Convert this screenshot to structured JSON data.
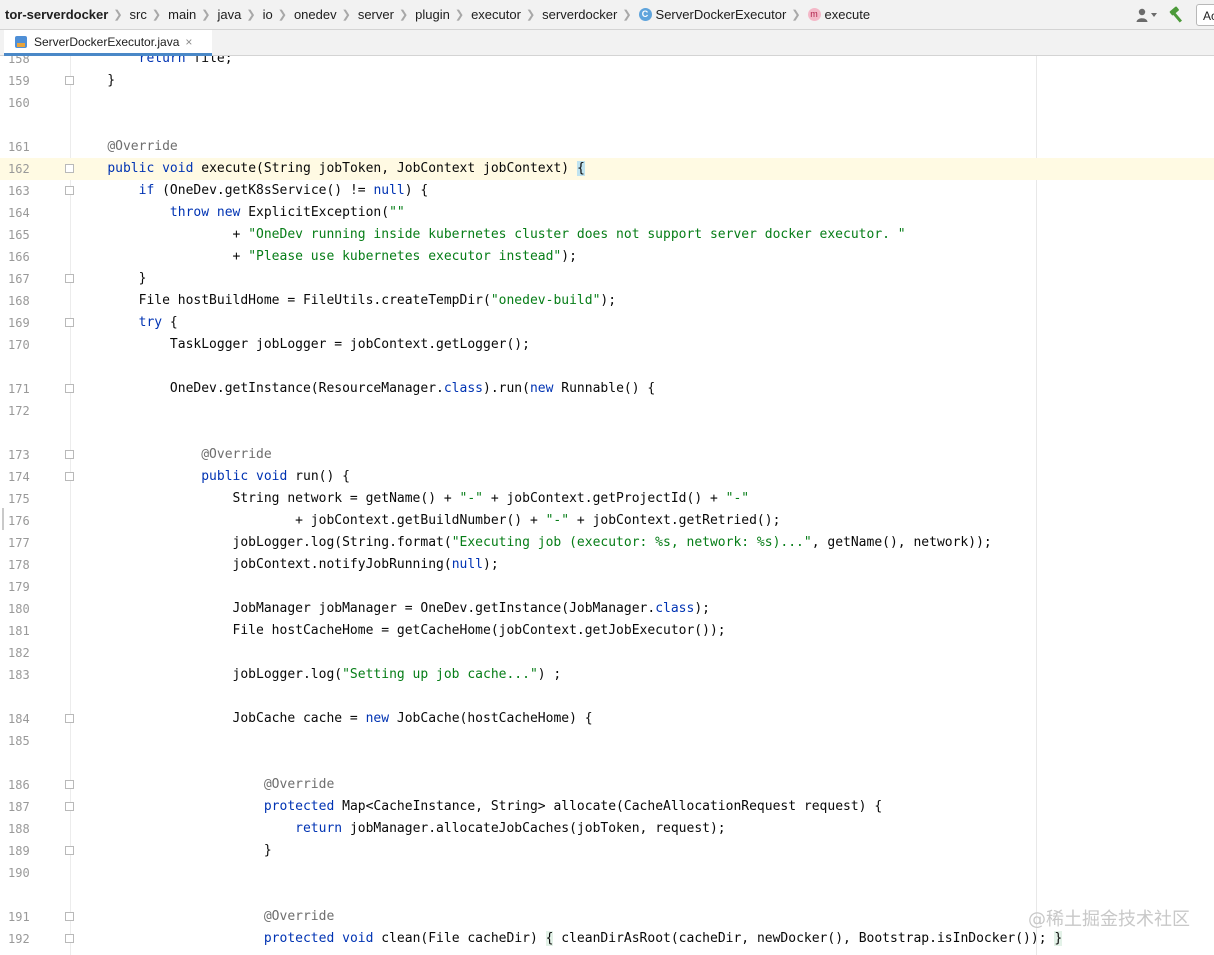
{
  "breadcrumb": {
    "items": [
      "tor-serverdocker",
      "src",
      "main",
      "java",
      "io",
      "onedev",
      "server",
      "plugin",
      "executor",
      "serverdocker",
      "ServerDockerExecutor",
      "execute"
    ],
    "class_badge": "C",
    "method_badge": "m"
  },
  "toolbar": {
    "right_button_label": "Ac"
  },
  "tab": {
    "label": "ServerDockerExecutor.java",
    "close": "×"
  },
  "editor": {
    "current_line": 162,
    "lines": [
      {
        "n": 158,
        "text": "        return file;"
      },
      {
        "n": 159,
        "text": "    }"
      },
      {
        "n": 160,
        "text": ""
      },
      {
        "n": 161,
        "text": "    @Override"
      },
      {
        "n": 162,
        "text": "    public void execute(String jobToken, JobContext jobContext) {"
      },
      {
        "n": 163,
        "text": "        if (OneDev.getK8sService() != null) {"
      },
      {
        "n": 164,
        "text": "            throw new ExplicitException(\"\""
      },
      {
        "n": 165,
        "text": "                    + \"OneDev running inside kubernetes cluster does not support server docker executor. \""
      },
      {
        "n": 166,
        "text": "                    + \"Please use kubernetes executor instead\");"
      },
      {
        "n": 167,
        "text": "        }"
      },
      {
        "n": 168,
        "text": "        File hostBuildHome = FileUtils.createTempDir(\"onedev-build\");"
      },
      {
        "n": 169,
        "text": "        try {"
      },
      {
        "n": 170,
        "text": "            TaskLogger jobLogger = jobContext.getLogger();"
      },
      {
        "n": 171,
        "text": "            OneDev.getInstance(ResourceManager.class).run(new Runnable() {"
      },
      {
        "n": 172,
        "text": ""
      },
      {
        "n": 173,
        "text": "                @Override"
      },
      {
        "n": 174,
        "text": "                public void run() {"
      },
      {
        "n": 175,
        "text": "                    String network = getName() + \"-\" + jobContext.getProjectId() + \"-\""
      },
      {
        "n": 176,
        "text": "                            + jobContext.getBuildNumber() + \"-\" + jobContext.getRetried();"
      },
      {
        "n": 177,
        "text": "                    jobLogger.log(String.format(\"Executing job (executor: %s, network: %s)...\", getName(), network));"
      },
      {
        "n": 178,
        "text": "                    jobContext.notifyJobRunning(null);"
      },
      {
        "n": 179,
        "text": ""
      },
      {
        "n": 180,
        "text": "                    JobManager jobManager = OneDev.getInstance(JobManager.class);"
      },
      {
        "n": 181,
        "text": "                    File hostCacheHome = getCacheHome(jobContext.getJobExecutor());"
      },
      {
        "n": 182,
        "text": ""
      },
      {
        "n": 183,
        "text": "                    jobLogger.log(\"Setting up job cache...\") ;"
      },
      {
        "n": 184,
        "text": "                    JobCache cache = new JobCache(hostCacheHome) {"
      },
      {
        "n": 185,
        "text": ""
      },
      {
        "n": 186,
        "text": "                        @Override"
      },
      {
        "n": 187,
        "text": "                        protected Map<CacheInstance, String> allocate(CacheAllocationRequest request) {"
      },
      {
        "n": 188,
        "text": "                            return jobManager.allocateJobCaches(jobToken, request);"
      },
      {
        "n": 189,
        "text": "                        }"
      },
      {
        "n": 190,
        "text": ""
      },
      {
        "n": 191,
        "text": "                        @Override"
      },
      {
        "n": 192,
        "text": "                        protected void clean(File cacheDir) { cleanDirAsRoot(cacheDir, newDocker(), Bootstrap.isInDocker()); }"
      }
    ]
  },
  "watermark": "@稀土掘金技术社区",
  "colors": {
    "keyword": "#0033b3",
    "string": "#067d17",
    "annotation": "#6e6e6e",
    "current_line": "#fffae3",
    "tab_underline": "#4a88c7"
  }
}
